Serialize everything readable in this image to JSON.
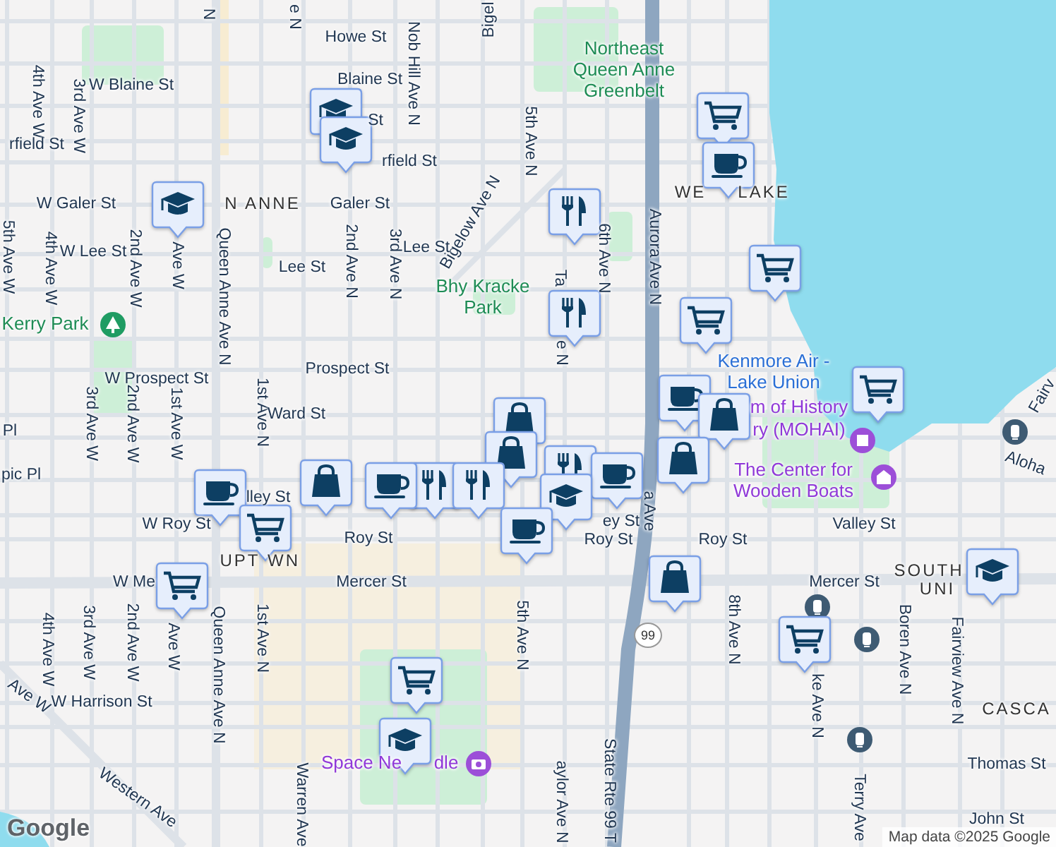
{
  "map": {
    "labels": [
      {
        "text": "N",
        "kind": "street"
      },
      {
        "text": "e N",
        "kind": "street"
      },
      {
        "text": "Bigel",
        "kind": "street"
      },
      {
        "text": "Howe St",
        "kind": "street"
      },
      {
        "text": "Nob Hill Ave N",
        "kind": "street"
      },
      {
        "text": "Northeast Queen Anne Greenbelt",
        "kind": "park"
      },
      {
        "text": "Blaine St",
        "kind": "street"
      },
      {
        "text": "W Blaine St",
        "kind": "street"
      },
      {
        "text": "4th Ave W",
        "kind": "street"
      },
      {
        "text": "3rd Ave W",
        "kind": "street"
      },
      {
        "text": "St",
        "kind": "street"
      },
      {
        "text": "rfield St",
        "kind": "street"
      },
      {
        "text": "rfield St",
        "kind": "street"
      },
      {
        "text": "5th Ave N",
        "kind": "street"
      },
      {
        "text": "WE",
        "kind": "area"
      },
      {
        "text": "LAKE",
        "kind": "area"
      },
      {
        "text": "W Galer St",
        "kind": "street"
      },
      {
        "text": "N ANNE",
        "kind": "area"
      },
      {
        "text": "Galer St",
        "kind": "street"
      },
      {
        "text": "Bigelow Ave N",
        "kind": "street"
      },
      {
        "text": "W Lee St",
        "kind": "street"
      },
      {
        "text": "Lee St",
        "kind": "street"
      },
      {
        "text": "Lee St",
        "kind": "street"
      },
      {
        "text": "5th Ave W",
        "kind": "street"
      },
      {
        "text": "4th Ave W",
        "kind": "street"
      },
      {
        "text": "2nd Ave W",
        "kind": "street"
      },
      {
        "text": "Ave W",
        "kind": "street"
      },
      {
        "text": "Queen Anne Ave N",
        "kind": "street"
      },
      {
        "text": "2nd Ave N",
        "kind": "street"
      },
      {
        "text": "3rd Ave N",
        "kind": "street"
      },
      {
        "text": "6th Ave N",
        "kind": "street"
      },
      {
        "text": "Aurora Ave N",
        "kind": "street"
      },
      {
        "text": "Ta",
        "kind": "street"
      },
      {
        "text": "e N",
        "kind": "street"
      },
      {
        "text": "Bhy Kracke Park",
        "kind": "park"
      },
      {
        "text": "Kerry Park",
        "kind": "park"
      },
      {
        "text": "W Prospect St",
        "kind": "street"
      },
      {
        "text": "Prospect St",
        "kind": "street"
      },
      {
        "text": "Kenmore Air - Lake Union",
        "kind": "transit"
      },
      {
        "text": "Fairv",
        "kind": "street"
      },
      {
        "text": "3rd Ave W",
        "kind": "street"
      },
      {
        "text": "2nd Ave W",
        "kind": "street"
      },
      {
        "text": "1st Ave W",
        "kind": "street"
      },
      {
        "text": "1st Ave N",
        "kind": "street"
      },
      {
        "text": "Ward St",
        "kind": "street"
      },
      {
        "text": "m of History",
        "kind": "museum"
      },
      {
        "text": "ry (MOHAI)",
        "kind": "museum"
      },
      {
        "text": "Pl",
        "kind": "street"
      },
      {
        "text": "Aloha",
        "kind": "street"
      },
      {
        "text": "pic Pl",
        "kind": "street"
      },
      {
        "text": "The Center for Wooden Boats",
        "kind": "museum"
      },
      {
        "text": "lley St",
        "kind": "street"
      },
      {
        "text": "a Ave",
        "kind": "street"
      },
      {
        "text": "W Roy St",
        "kind": "street"
      },
      {
        "text": "ey St",
        "kind": "street"
      },
      {
        "text": "Valley St",
        "kind": "street"
      },
      {
        "text": "Roy St",
        "kind": "street"
      },
      {
        "text": "Roy St",
        "kind": "street"
      },
      {
        "text": "Roy St",
        "kind": "street"
      },
      {
        "text": "UPT",
        "kind": "area"
      },
      {
        "text": "WN",
        "kind": "area"
      },
      {
        "text": "SOUTH",
        "kind": "area"
      },
      {
        "text": "W Me",
        "kind": "street"
      },
      {
        "text": "Mercer St",
        "kind": "street"
      },
      {
        "text": "Mercer St",
        "kind": "street"
      },
      {
        "text": "UNI",
        "kind": "area"
      },
      {
        "text": "4th Ave W",
        "kind": "street"
      },
      {
        "text": "3rd Ave W",
        "kind": "street"
      },
      {
        "text": "2nd Ave W",
        "kind": "street"
      },
      {
        "text": "Ave W",
        "kind": "street"
      },
      {
        "text": "Queen Anne Ave N",
        "kind": "street"
      },
      {
        "text": "1st Ave N",
        "kind": "street"
      },
      {
        "text": "5th Ave N",
        "kind": "street"
      },
      {
        "text": "8th Ave N",
        "kind": "street"
      },
      {
        "text": "ke Ave N",
        "kind": "street"
      },
      {
        "text": "Boren Ave N",
        "kind": "street"
      },
      {
        "text": "Fairview Ave N",
        "kind": "street"
      },
      {
        "text": "Ave W",
        "kind": "street"
      },
      {
        "text": "W Harrison St",
        "kind": "street"
      },
      {
        "text": "CASCA",
        "kind": "area"
      },
      {
        "text": "Space Ne",
        "kind": "museum"
      },
      {
        "text": "dle",
        "kind": "museum"
      },
      {
        "text": "Thomas St",
        "kind": "street"
      },
      {
        "text": "State Rte 99 T",
        "kind": "street"
      },
      {
        "text": "Warren Ave",
        "kind": "street"
      },
      {
        "text": "Western Ave",
        "kind": "street"
      },
      {
        "text": "aylor Ave N",
        "kind": "street"
      },
      {
        "text": "Terry Ave",
        "kind": "street"
      },
      {
        "text": "John St",
        "kind": "street"
      }
    ],
    "route_shield": "99",
    "markers": [
      {
        "kind": "school"
      },
      {
        "kind": "cart"
      },
      {
        "kind": "school"
      },
      {
        "kind": "cup"
      },
      {
        "kind": "school"
      },
      {
        "kind": "restaurant"
      },
      {
        "kind": "cart"
      },
      {
        "kind": "restaurant"
      },
      {
        "kind": "cart"
      },
      {
        "kind": "cart"
      },
      {
        "kind": "cup"
      },
      {
        "kind": "bag"
      },
      {
        "kind": "bag"
      },
      {
        "kind": "bag"
      },
      {
        "kind": "restaurant"
      },
      {
        "kind": "bag"
      },
      {
        "kind": "restaurant"
      },
      {
        "kind": "cup"
      },
      {
        "kind": "bag"
      },
      {
        "kind": "restaurant"
      },
      {
        "kind": "cup"
      },
      {
        "kind": "school"
      },
      {
        "kind": "cup"
      },
      {
        "kind": "cart"
      },
      {
        "kind": "bag"
      },
      {
        "kind": "cart"
      },
      {
        "kind": "cup"
      },
      {
        "kind": "cart"
      },
      {
        "kind": "school"
      },
      {
        "kind": "cart"
      },
      {
        "kind": "school"
      }
    ]
  },
  "logo": "Google",
  "attribution": "Map data ©2025 Google"
}
